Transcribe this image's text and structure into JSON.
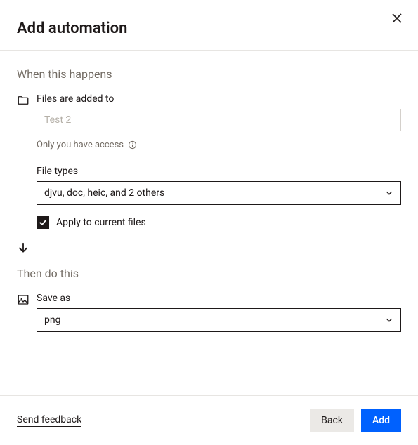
{
  "header": {
    "title": "Add automation"
  },
  "when": {
    "section_label": "When this happens",
    "trigger_label": "Files are added to",
    "folder_placeholder": "Test 2",
    "folder_value": "",
    "access_note": "Only you have access",
    "file_types_label": "File types",
    "file_types_value": "djvu, doc, heic, and 2 others",
    "apply_label": "Apply to current files",
    "apply_checked": true
  },
  "then": {
    "section_label": "Then do this",
    "action_label": "Save as",
    "format_value": "png"
  },
  "footer": {
    "feedback": "Send feedback",
    "back": "Back",
    "add": "Add"
  }
}
